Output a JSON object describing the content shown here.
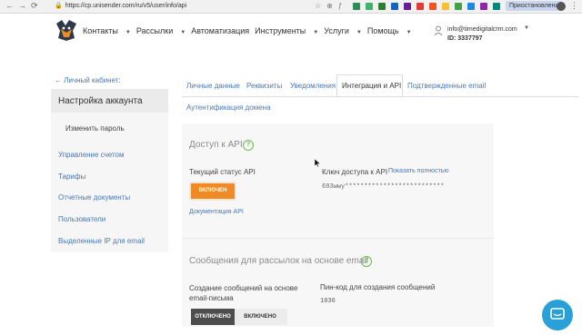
{
  "browser": {
    "url": "https://cp.unisender.com/ru/v5/user/info/api",
    "paused_label": "Приостановлена"
  },
  "nav": {
    "items": [
      {
        "label": "Контакты",
        "caret": true
      },
      {
        "label": "Рассылки",
        "caret": true
      },
      {
        "label": "Автоматизация",
        "caret": false
      },
      {
        "label": "Инструменты",
        "caret": true
      },
      {
        "label": "Услуги",
        "caret": true
      },
      {
        "label": "Помощь",
        "caret": true
      }
    ],
    "account_email": "info@timedigitalcrm.com",
    "account_id": "ID: 3337797"
  },
  "sidebar": {
    "back_link": "← Личный кабинет:",
    "title": "Настройка аккаунта",
    "sub_item": "Изменить пароль",
    "links": [
      "Управление счетом",
      "Тарифы",
      "Отчетные документы",
      "Пользователи",
      "Выделенные IP для email"
    ]
  },
  "tabs": {
    "items": [
      "Личные данные",
      "Реквизиты",
      "Уведомления",
      "Интеграция и API",
      "Подтвержденные email",
      "Аутентификация домена"
    ],
    "active": "Интеграция и API"
  },
  "api_section": {
    "title": "Доступ к API",
    "status_label": "Текущий статус API",
    "status_button": "ВКЛЮЧЕН",
    "docs_link": "Документация API",
    "key_label": "Ключ доступа к API",
    "show_link": "Показать полностью",
    "key_value": "693wwy**************************"
  },
  "messages_section": {
    "title": "Сообщения для рассылок на основе email",
    "create_label": "Создание сообщений на основе email-письма",
    "off_label": "ОТКЛЮЧЕНО",
    "on_label": "ВКЛЮЧЕНО",
    "pin_label": "Пин-код для создания сообщений",
    "pin_value": "1036"
  },
  "colors": {
    "accent": "#f08a24",
    "link": "#4a78b3",
    "help": "#6cba4c",
    "chat": "#2aa0d8"
  }
}
